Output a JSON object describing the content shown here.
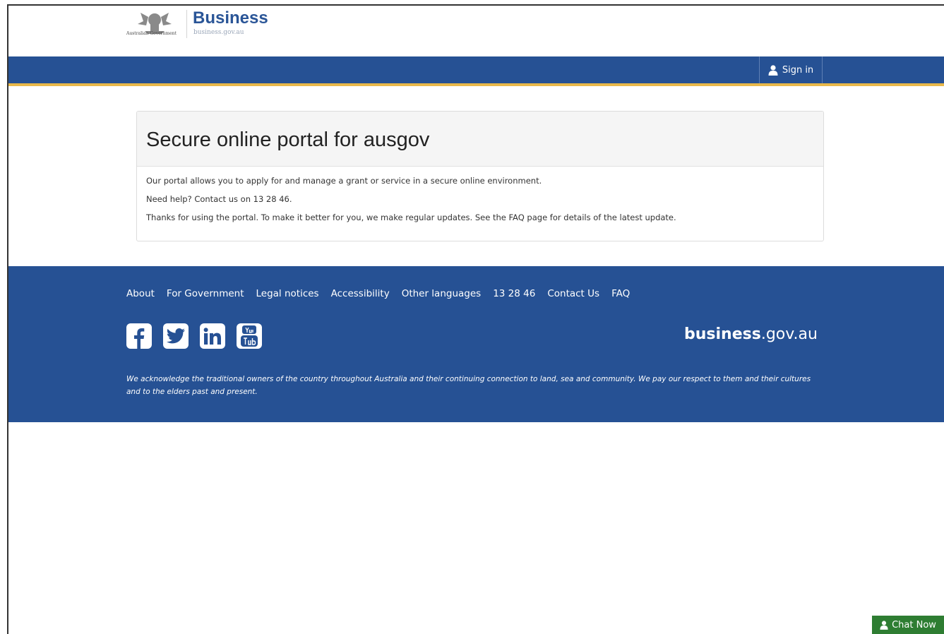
{
  "header": {
    "gov_label": "Australian Government",
    "brand_title": "Business",
    "brand_sub": "business.gov.au",
    "crest_icon": "coat-of-arms-icon"
  },
  "nav": {
    "signin_label": "Sign in",
    "signin_icon": "user-icon"
  },
  "panel": {
    "title": "Secure online portal for ausgov",
    "paragraphs": [
      "Our portal allows you to apply for and manage a grant or service in a secure online environment.",
      "Need help? Contact us on 13 28 46.",
      "Thanks for using the portal. To make it better for you, we make regular updates. See the FAQ page for details of the latest update."
    ]
  },
  "footer": {
    "links": [
      "About",
      "For Government",
      "Legal notices",
      "Accessibility",
      "Other languages",
      "13 28 46",
      "Contact Us",
      "FAQ"
    ],
    "social": [
      "facebook-icon",
      "twitter-icon",
      "linkedin-icon",
      "youtube-icon"
    ],
    "brand_bold": "business",
    "brand_rest": ".gov.au",
    "acknowledgement": "We acknowledge the traditional owners of the country throughout Australia and their continuing connection to land, sea and community. We pay our respect to them and their cultures and to the elders past and present."
  },
  "chat": {
    "label": "Chat Now",
    "icon": "user-icon"
  },
  "colors": {
    "brand_blue": "#265194",
    "accent_gold": "#e8b84a",
    "chat_green": "#2e7d32"
  }
}
